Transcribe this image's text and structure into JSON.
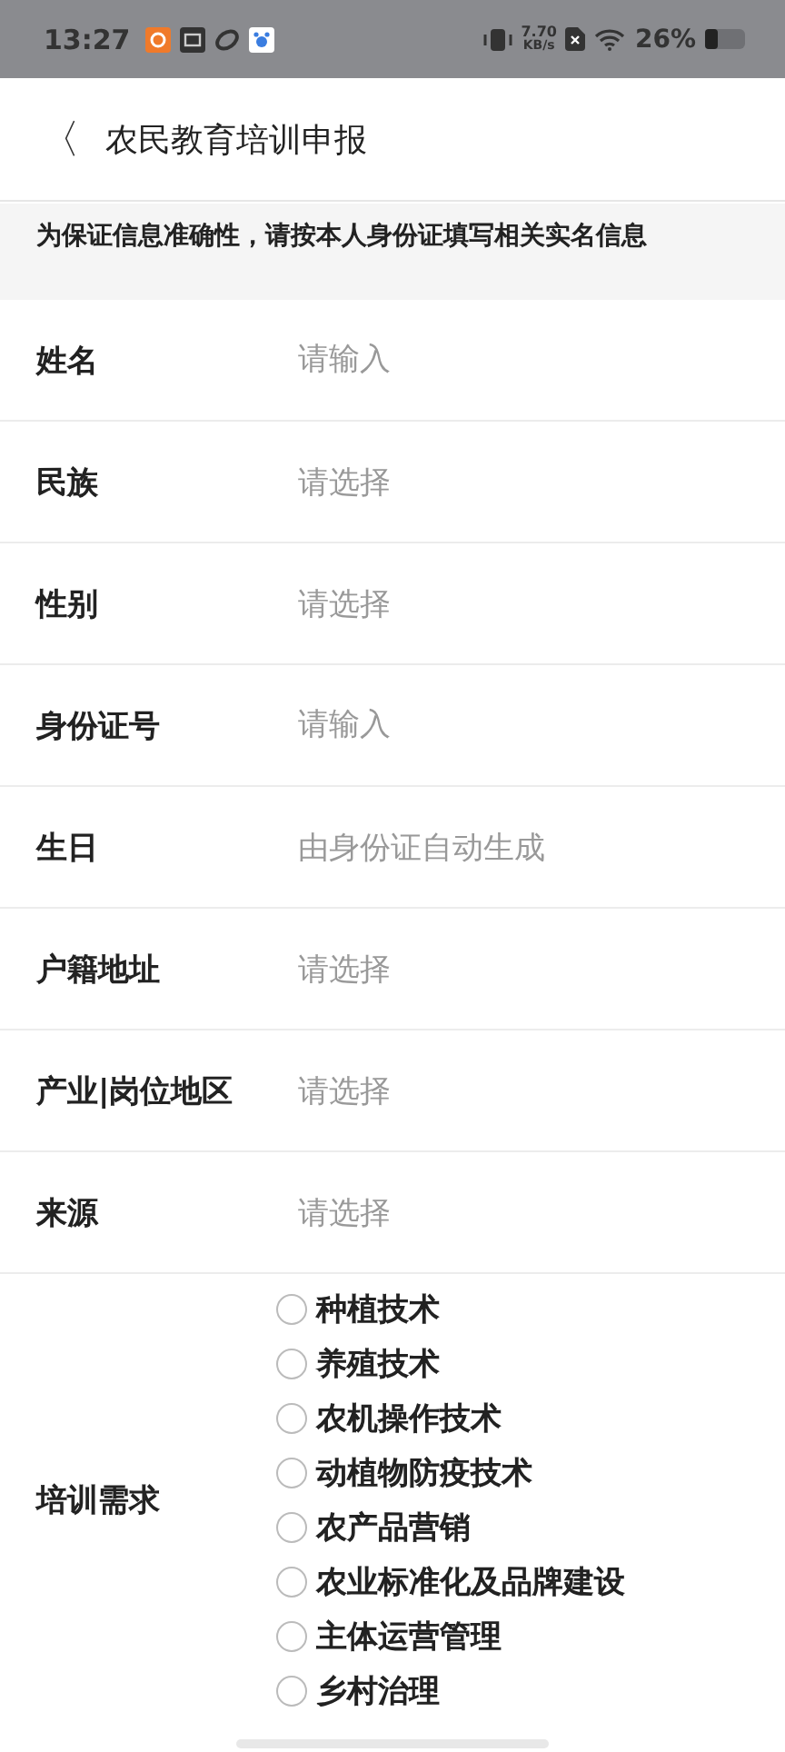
{
  "status_bar": {
    "time": "13:27",
    "speed_value": "7.70",
    "speed_unit": "KB/s",
    "battery": "26%"
  },
  "header": {
    "back": "〈",
    "title": "农民教育培训申报"
  },
  "notice": "为保证信息准确性，请按本人身份证填写相关实名信息",
  "fields": [
    {
      "label": "姓名",
      "placeholder": "请输入",
      "kind": "input"
    },
    {
      "label": "民族",
      "placeholder": "请选择",
      "kind": "select"
    },
    {
      "label": "性别",
      "placeholder": "请选择",
      "kind": "select"
    },
    {
      "label": "身份证号",
      "placeholder": "请输入",
      "kind": "input"
    },
    {
      "label": "生日",
      "placeholder": "由身份证自动生成",
      "kind": "select"
    },
    {
      "label": "户籍地址",
      "placeholder": "请选择",
      "kind": "select"
    },
    {
      "label": "产业|岗位地区",
      "placeholder": "请选择",
      "kind": "select"
    },
    {
      "label": "来源",
      "placeholder": "请选择",
      "kind": "select"
    }
  ],
  "training": {
    "label": "培训需求",
    "options": [
      {
        "label": "种植技术",
        "selected": false
      },
      {
        "label": "养殖技术",
        "selected": false
      },
      {
        "label": "农机操作技术",
        "selected": false
      },
      {
        "label": "动植物防疫技术",
        "selected": false
      },
      {
        "label": "农产品营销",
        "selected": false
      },
      {
        "label": "农业标准化及品牌建设",
        "selected": false
      },
      {
        "label": "主体运营管理",
        "selected": false
      },
      {
        "label": "乡村治理",
        "selected": false
      }
    ]
  }
}
